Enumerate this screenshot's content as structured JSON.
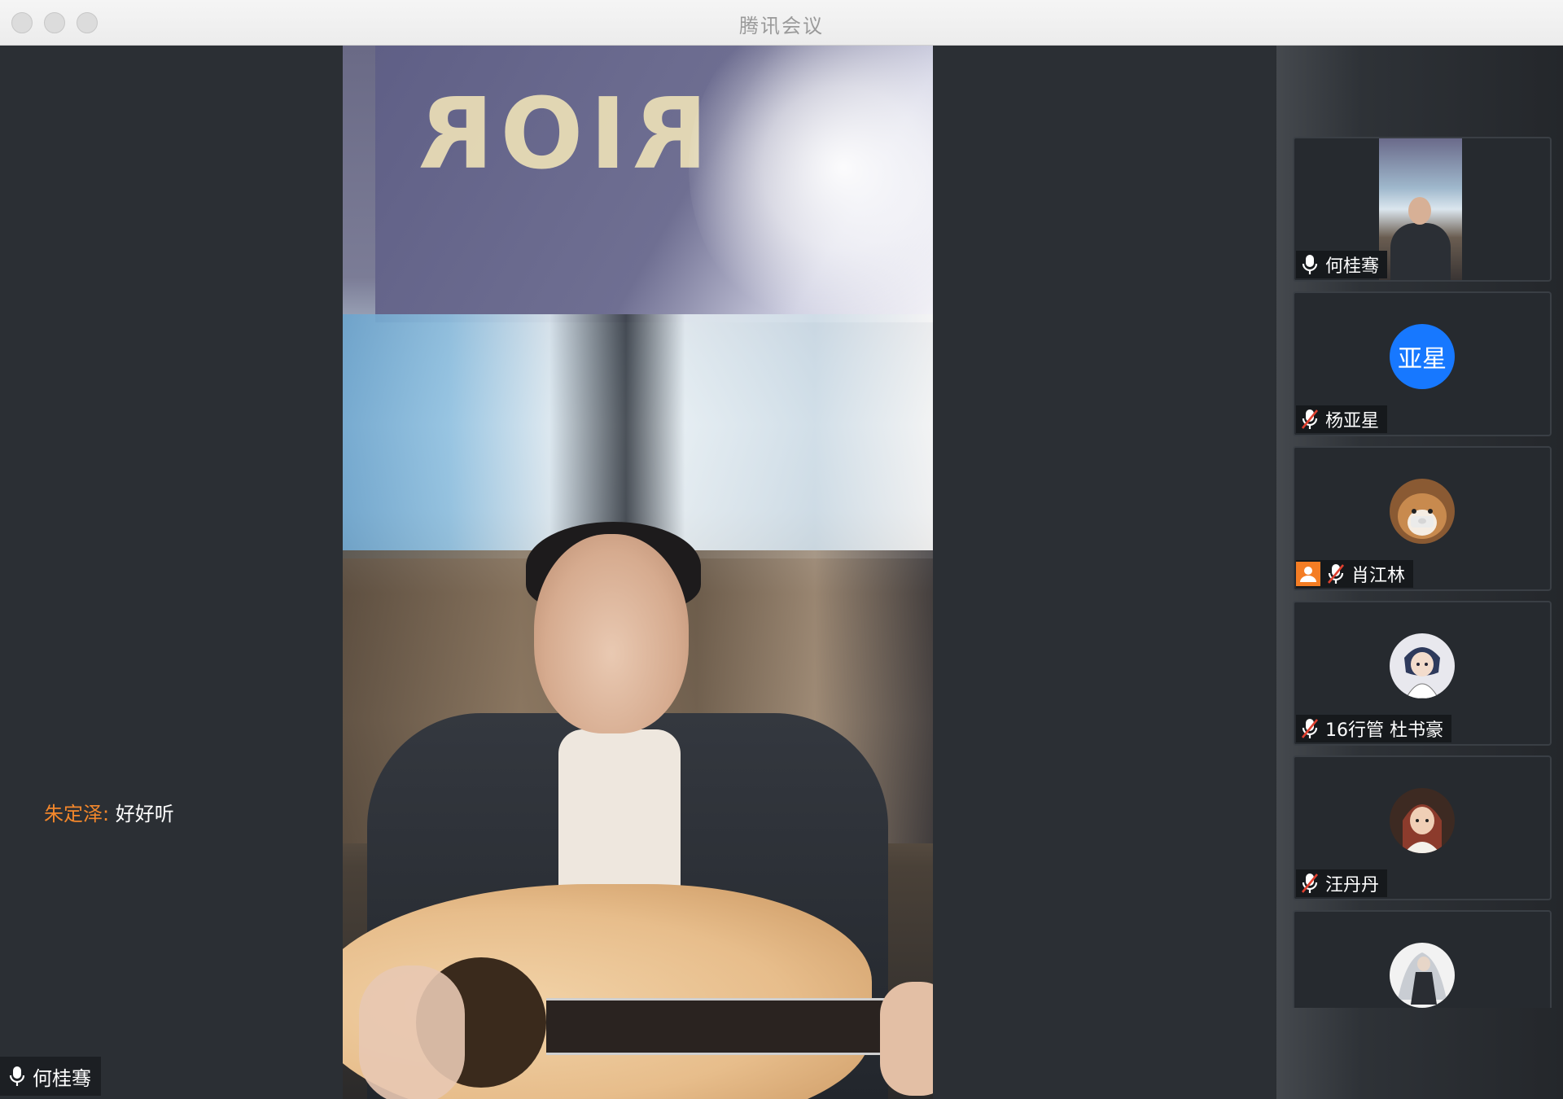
{
  "window": {
    "title": "腾讯会议"
  },
  "stage": {
    "video_overlay_text": "RIOR",
    "chat": {
      "sender": "朱定泽:",
      "message": "好好听"
    },
    "speaker_label": "何桂骞"
  },
  "participants": [
    {
      "name": "何桂骞",
      "mic": "on",
      "avatar": "video-thumbnail"
    },
    {
      "name": "杨亚星",
      "mic": "muted",
      "avatar_text": "亚星",
      "avatar_color": "#1778ff"
    },
    {
      "name": "肖江林",
      "mic": "muted",
      "host": true,
      "avatar": "shiba-dog-avatar"
    },
    {
      "name": "16行管 杜书豪",
      "mic": "muted",
      "avatar": "anime-character-avatar"
    },
    {
      "name": "汪丹丹",
      "mic": "muted",
      "avatar": "cartoon-person-avatar"
    },
    {
      "name": "",
      "mic": "",
      "avatar": "illustrated-figure-avatar"
    }
  ],
  "colors": {
    "accent": "#1778ff",
    "chat_name": "#f3872b",
    "host_badge": "#f47d24",
    "muted_slash": "#e0402f"
  }
}
